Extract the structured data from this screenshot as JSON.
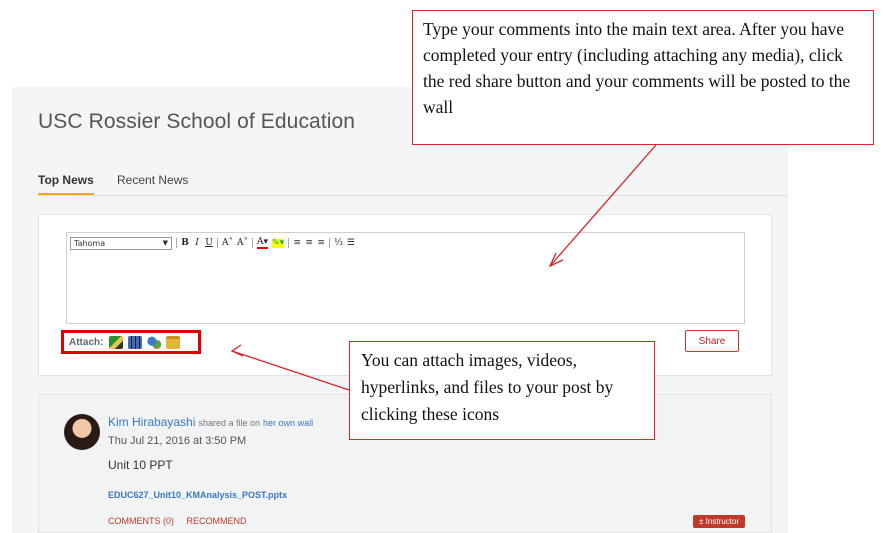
{
  "page": {
    "title": "USC Rossier School of Education"
  },
  "tabs": [
    {
      "label": "Top News",
      "active": true
    },
    {
      "label": "Recent News",
      "active": false
    }
  ],
  "editor": {
    "font": "Tahoma",
    "toolbar": {
      "bold": "B",
      "italic": "I",
      "underline": "U",
      "grow": "A˄",
      "shrink": "A˅",
      "font_color": "A▾",
      "highlight": "✎▾",
      "align_left": "≡",
      "align_center": "≡",
      "align_right": "≡",
      "numbered_list": "⅓",
      "bulleted_list": "☰"
    }
  },
  "attach": {
    "label": "Attach:",
    "icons": [
      "image-icon",
      "video-icon",
      "hyperlink-icon",
      "folder-icon"
    ]
  },
  "share": {
    "label": "Share"
  },
  "post": {
    "author": "Kim Hirabayashi",
    "action": "shared a file on",
    "target": "her own wall",
    "timestamp": "Thu Jul 21, 2016 at 3:50 PM",
    "text": "Unit 10 PPT",
    "attachment": "EDUC627_Unit10_KMAnalysis_POST.pptx",
    "comments_label": "COMMENTS (0)",
    "recommend_label": "RECOMMEND",
    "badge": "± Instructor"
  },
  "callouts": {
    "top": "Type your comments into the main text area. After you have completed your entry (including attaching any media), click the red share button and your comments will be posted to the wall",
    "bottom": "You can attach images, videos, hyperlinks, and files to your post by clicking these icons"
  },
  "colors": {
    "accent_red": "#d9252b",
    "link_blue": "#3a78c2",
    "tab_underline": "#f0a81c"
  }
}
